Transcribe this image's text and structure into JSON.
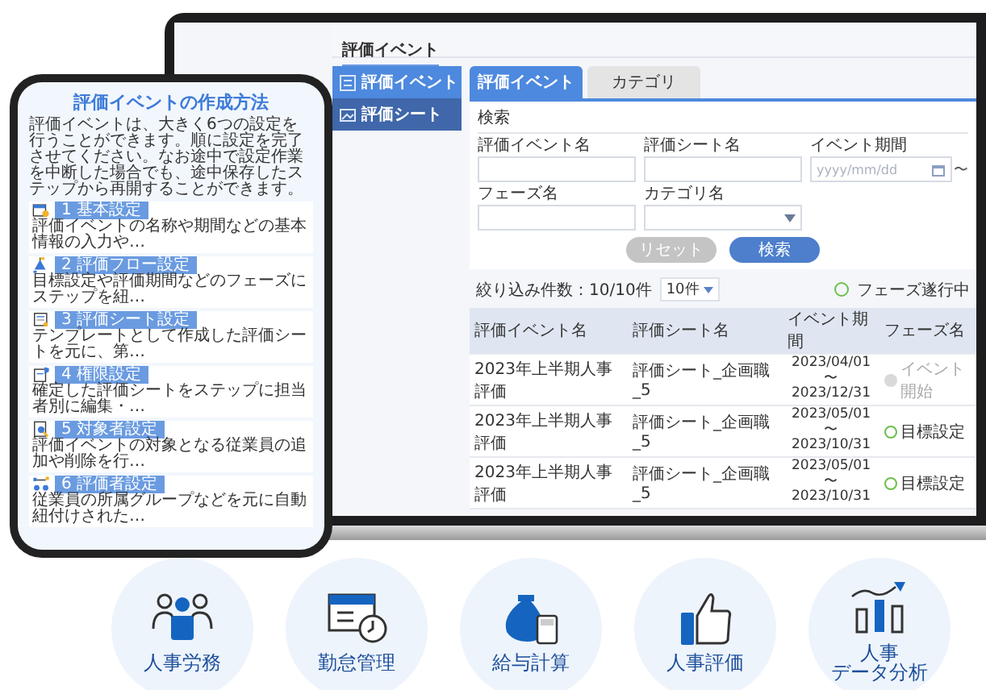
{
  "phone": {
    "title": "評価イベントの作成方法",
    "intro": "評価イベントは、大きく6つの設定を行うことができます。順に設定を完了させてください。なお途中で設定作業を中断した場合でも、途中保存したステップから再開することができます。",
    "steps": [
      {
        "title": "1 基本設定",
        "description": "評価イベントの名称や期間などの基本情報の入力や…"
      },
      {
        "title": "2 評価フロー設定",
        "description": "目標設定や評価期間などのフェーズにステップを紐…"
      },
      {
        "title": "3 評価シート設定",
        "description": "テンプレートとして作成した評価シートを元に、第…"
      },
      {
        "title": "4 権限設定",
        "description": "確定した評価シートをステップに担当者別に編集・…"
      },
      {
        "title": "5 対象者設定",
        "description": "評価イベントの対象となる従業員の追加や削除を行…"
      },
      {
        "title": "6 評価者設定",
        "description": "従業員の所属グループなどを元に自動紐付けされた…"
      }
    ]
  },
  "laptop": {
    "page_title": "評価イベント",
    "sidebar": [
      {
        "label": "評価イベント",
        "selected": true
      },
      {
        "label": "評価シート",
        "selected": false
      }
    ],
    "tabs": [
      {
        "label": "評価イベント",
        "selected": true
      },
      {
        "label": "カテゴリ",
        "selected": false
      }
    ],
    "search": {
      "heading": "検索",
      "fields": [
        {
          "kind": "text",
          "label": "評価イベント名"
        },
        {
          "kind": "text",
          "label": "評価シート名"
        },
        {
          "kind": "date",
          "label": "イベント期間",
          "placeholder": "yyyy/mm/dd",
          "separator": "〜"
        },
        {
          "kind": "text",
          "label": "フェーズ名"
        },
        {
          "kind": "select",
          "label": "カテゴリ名"
        }
      ],
      "buttons": [
        {
          "label": "リセット",
          "disabled": true
        },
        {
          "label": "検索",
          "disabled": false
        }
      ]
    },
    "results": {
      "count": "絞り込み件数：10/10件",
      "page_size": "10件",
      "legend": [
        {
          "label": "フェーズ遂行中",
          "color": "#6cc04a"
        }
      ]
    },
    "table": {
      "columns": [
        "評価イベント名",
        "評価シート名",
        "イベント期間",
        "フェーズ名"
      ],
      "rows": [
        {
          "event": "2023年上半期人事評価",
          "sheet": "評価シート_企画職_5",
          "start": "2023/04/01",
          "separator": "〜",
          "end": "2023/12/31",
          "phase": "イベント開始",
          "kind": "pending"
        },
        {
          "event": "2023年上半期人事評価",
          "sheet": "評価シート_企画職_5",
          "start": "2023/05/01",
          "separator": "〜",
          "end": "2023/10/31",
          "phase": "目標設定",
          "kind": "active"
        },
        {
          "event": "2023年上半期人事評価",
          "sheet": "評価シート_企画職_5",
          "start": "2023/05/01",
          "separator": "〜",
          "end": "2023/10/31",
          "phase": "目標設定",
          "kind": "active"
        }
      ]
    }
  },
  "services": [
    {
      "label": "人事労務"
    },
    {
      "label": "勤怠管理"
    },
    {
      "label": "給与計算"
    },
    {
      "label": "人事評価"
    },
    {
      "lines": [
        "人事",
        "データ分析"
      ]
    }
  ]
}
